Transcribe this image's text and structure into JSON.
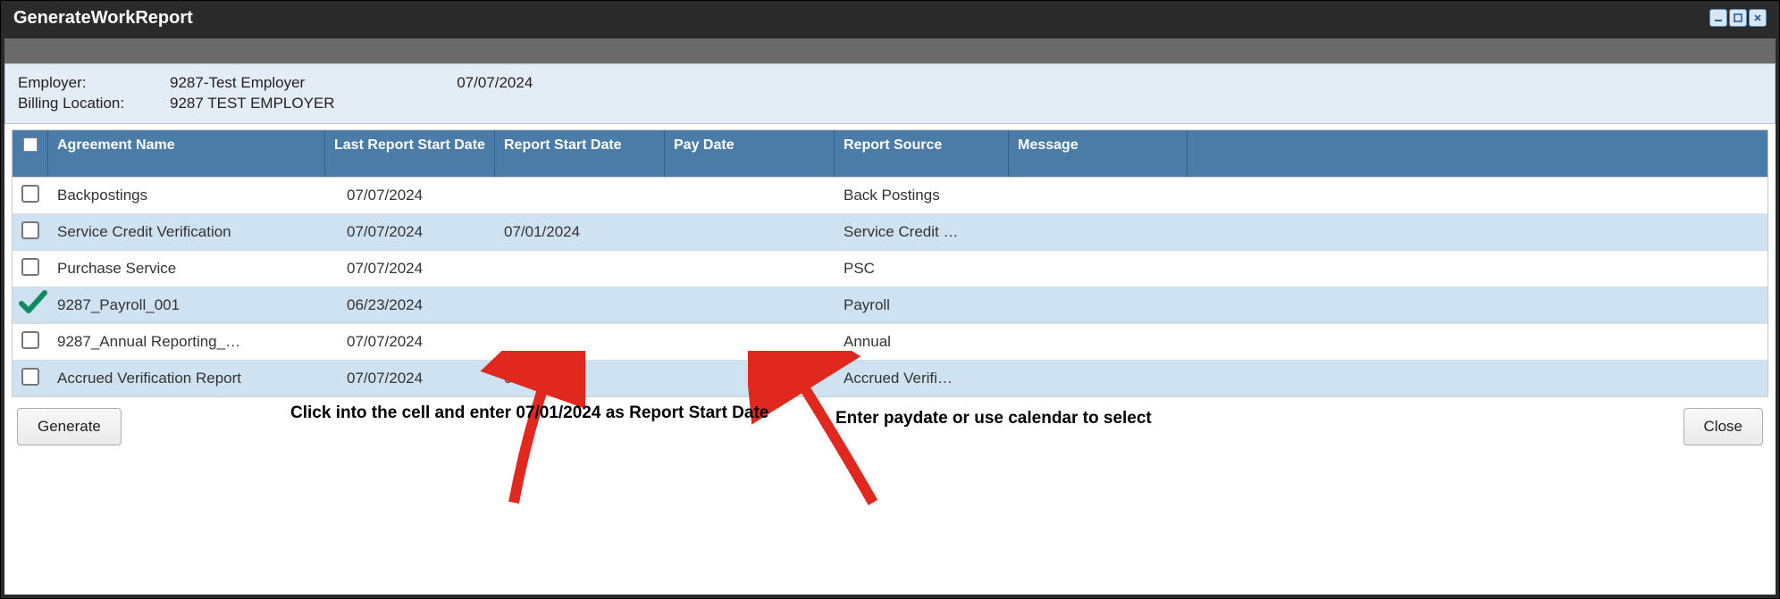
{
  "title": "GenerateWorkReport",
  "header": {
    "employer_label": "Employer:",
    "employer_value": "9287-Test Employer",
    "billing_label": "Billing Location:",
    "billing_value": "9287 TEST EMPLOYER",
    "date": "07/07/2024"
  },
  "columns": {
    "agreement": "Agreement Name",
    "last_report": "Last Report Start Date",
    "report_start": "Report Start Date",
    "pay_date": "Pay Date",
    "report_source": "Report Source",
    "message": "Message"
  },
  "rows": [
    {
      "checked": false,
      "name": "Backpostings",
      "last": "07/07/2024",
      "start": "",
      "pay": "",
      "source": "Back Postings",
      "msg": ""
    },
    {
      "checked": false,
      "name": "Service Credit Verification",
      "last": "07/07/2024",
      "start": "07/01/2024",
      "pay": "",
      "source": "Service Credit …",
      "msg": ""
    },
    {
      "checked": false,
      "name": "Purchase Service",
      "last": "07/07/2024",
      "start": "",
      "pay": "",
      "source": "PSC",
      "msg": ""
    },
    {
      "checked": true,
      "name": "9287_Payroll_001",
      "last": "06/23/2024",
      "start": "",
      "pay": "",
      "source": "Payroll",
      "msg": ""
    },
    {
      "checked": false,
      "name": "9287_Annual Reporting_…",
      "last": "07/07/2024",
      "start": "",
      "pay": "",
      "source": "Annual",
      "msg": ""
    },
    {
      "checked": false,
      "name": "Accrued Verification Report",
      "last": "07/07/2024",
      "start": "07/01/2024",
      "pay": "",
      "source": "Accrued Verifi…",
      "msg": ""
    }
  ],
  "buttons": {
    "generate": "Generate",
    "close": "Close"
  },
  "annotations": {
    "left": "Click into the cell and enter 07/01/2024 as Report Start Date",
    "right": "Enter paydate or use calendar to select"
  }
}
